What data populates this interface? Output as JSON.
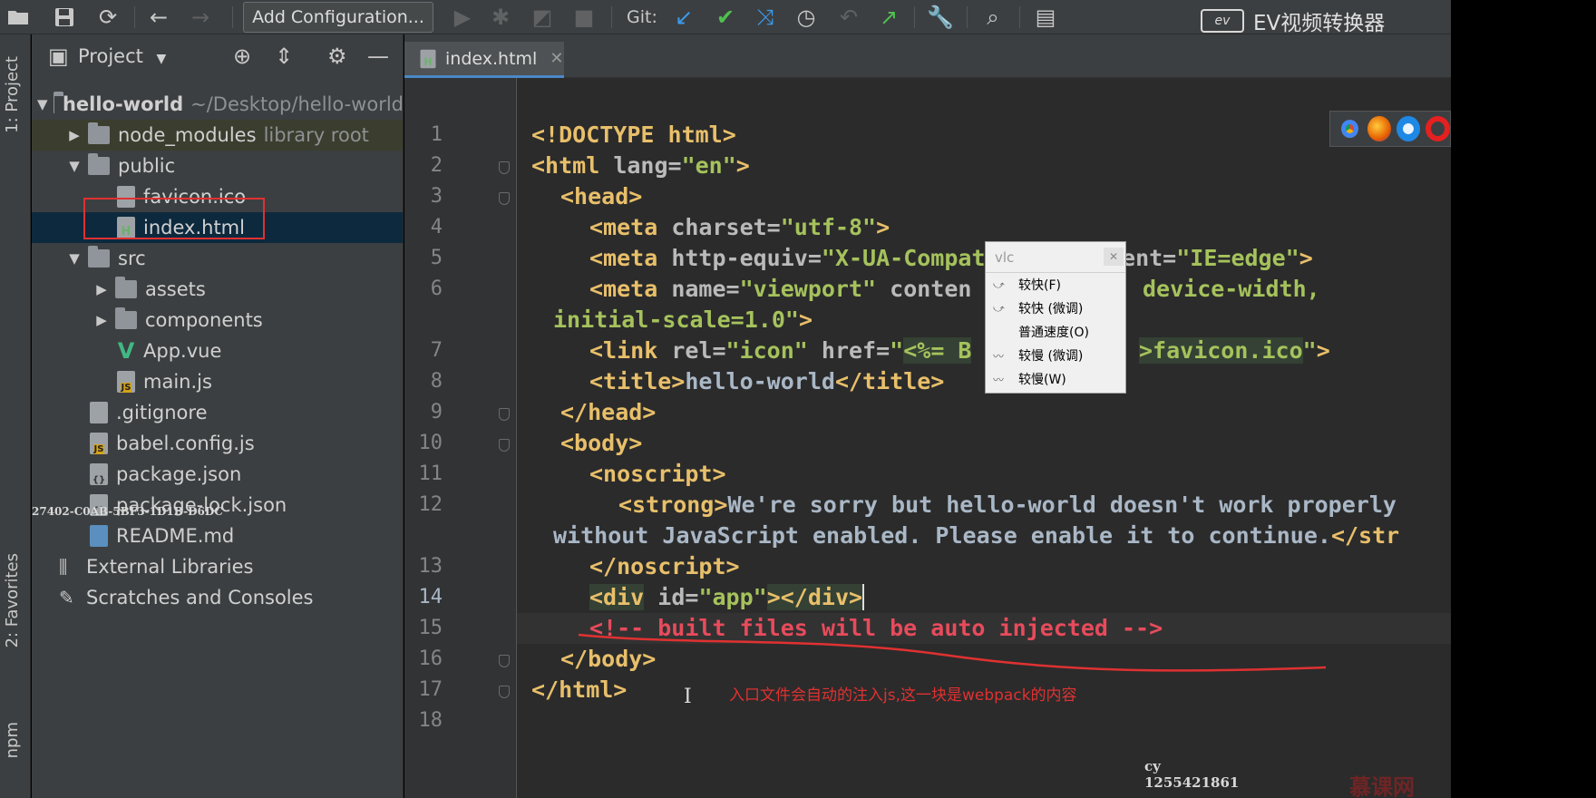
{
  "toolbar": {
    "add_config_label": "Add Configuration...",
    "git_label": "Git:"
  },
  "watermark": {
    "logo": "ev",
    "text": "EV视频转换器"
  },
  "tool_strip": {
    "project_tab": "1: Project",
    "favorites_tab": "2: Favorites",
    "npm_tab": "npm"
  },
  "project": {
    "title": "Project",
    "root": {
      "name": "hello-world",
      "path": "~/Desktop/hello-world"
    },
    "items": [
      {
        "label": "node_modules",
        "note": "library root"
      },
      {
        "label": "public"
      },
      {
        "label": "favicon.ico"
      },
      {
        "label": "index.html"
      },
      {
        "label": "src"
      },
      {
        "label": "assets"
      },
      {
        "label": "components"
      },
      {
        "label": "App.vue"
      },
      {
        "label": "main.js"
      },
      {
        "label": ".gitignore"
      },
      {
        "label": "babel.config.js"
      },
      {
        "label": "package.json"
      },
      {
        "label": "package-lock.json"
      },
      {
        "label": "README.md"
      },
      {
        "label": "External Libraries"
      },
      {
        "label": "Scratches and Consoles"
      }
    ],
    "overlay_id": "27402-C0AB-5BF3-1D1B-D6DC"
  },
  "editor": {
    "tab_label": "index.html",
    "line_numbers": [
      "1",
      "2",
      "3",
      "4",
      "5",
      "6",
      "7",
      "8",
      "9",
      "10",
      "11",
      "12",
      "13",
      "14",
      "15",
      "16",
      "17",
      "18"
    ],
    "code": {
      "l1_tag": "<!DOCTYPE html>",
      "l2_open": "<html",
      "l2_attr": " lang=",
      "l2_val": "\"en\"",
      "l2_close": ">",
      "l3": "<head>",
      "l4_open": "<meta",
      "l4_attr": " charset=",
      "l4_val": "\"utf-8\"",
      "l4_close": ">",
      "l5_open": "<meta",
      "l5_attr1": " http-equiv=",
      "l5_val1": "\"X-UA-Compatible\"",
      "l5_attr2": " content=",
      "l5_val2": "\"IE=edge\"",
      "l5_close": ">",
      "l6_open": "<meta",
      "l6_attr1": " name=",
      "l6_val1": "\"viewport\"",
      "l6_attr2": " conten",
      "l6_val2": "device-width,",
      "l6b_val": "initial-scale=1.0\"",
      "l6b_close": ">",
      "l7_open": "<link",
      "l7_attr1": " rel=",
      "l7_val1": "\"icon\"",
      "l7_attr2": " href=",
      "l7_val2a": "\"",
      "l7_tpl": "<%= B",
      "l7_tpl2": ">favicon.ico",
      "l7_val2b": "\"",
      "l7_close": ">",
      "l8_open": "<title>",
      "l8_text": "hello-world",
      "l8_close": "</title>",
      "l9": "</head>",
      "l10": "<body>",
      "l11": "<noscript>",
      "l12_open": "<strong>",
      "l12_text": "We're sorry but hello-world doesn't work properly",
      "l12b_text": "without JavaScript enabled. Please enable it to continue.",
      "l12b_close": "</str",
      "l13": "</noscript>",
      "l14_open": "<div",
      "l14_attr": " id=",
      "l14_val": "\"app\"",
      "l14_close": "></div>",
      "l15": "<!-- built files will be auto injected -->",
      "l16": "</body>",
      "l17": "</html>"
    }
  },
  "vlc_popup": {
    "title": "vlc",
    "items": [
      "较快(F)",
      "较快 (微调)",
      "普通速度(O)",
      "较慢 (微调)",
      "较慢(W)"
    ]
  },
  "annotation": {
    "note": "入口文件会自动的注入js,这一块是webpack的内容",
    "cy_name": "cy",
    "cy_number": "1255421861",
    "site_mark": "慕课网"
  },
  "colors": {
    "accent": "#4a88c7",
    "annotation_red": "#e03131"
  }
}
